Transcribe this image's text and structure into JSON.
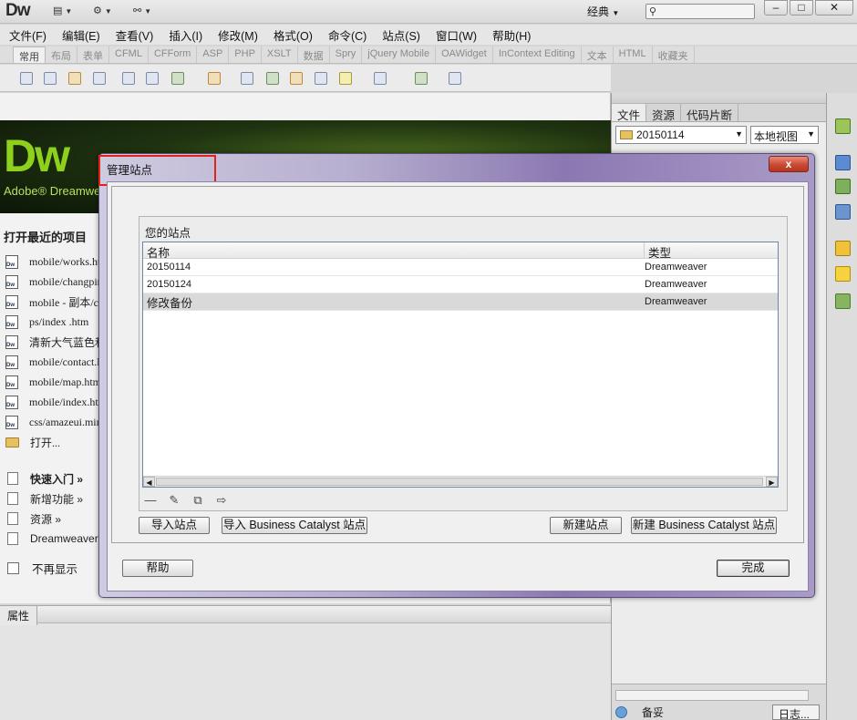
{
  "app": {
    "logo": "Dw",
    "workspace": "经典",
    "window_buttons": [
      "–",
      "□",
      "✕"
    ]
  },
  "menu": [
    "文件(F)",
    "编辑(E)",
    "查看(V)",
    "插入(I)",
    "修改(M)",
    "格式(O)",
    "命令(C)",
    "站点(S)",
    "窗口(W)",
    "帮助(H)"
  ],
  "insert_tabs": [
    "常用",
    "布局",
    "表单",
    "CFML",
    "CFForm",
    "ASP",
    "PHP",
    "XSLT",
    "数据",
    "Spry",
    "jQuery Mobile",
    "OAWidget",
    "InContext Editing",
    "文本",
    "HTML",
    "收藏夹"
  ],
  "start_page": {
    "logo": "Dw",
    "brand": "Adobe® Dreamweaver",
    "recent_title": "打开最近的项目",
    "recent_items": [
      "mobile/works.ht",
      "mobile/changpin",
      "mobile - 副本/c",
      "ps/index .htm",
      "清新大气蓝色和",
      "mobile/contact.l",
      "mobile/map.htm",
      "mobile/index.htm",
      "css/amazeui.min"
    ],
    "open_label": "打开...",
    "quick_links": [
      "快速入门 »",
      "新增功能 »",
      "资源 »",
      "Dreamweaver E"
    ],
    "dont_show": "不再显示"
  },
  "properties": {
    "tab": "属性"
  },
  "files_panel": {
    "tabs": [
      "文件",
      "资源",
      "代码片断"
    ],
    "site": "20150114",
    "view": "本地视图",
    "status": "备妥",
    "log_button": "日志..."
  },
  "dialog": {
    "title": "管理站点",
    "close": "x",
    "group_label": "您的站点",
    "columns": [
      "名称",
      "类型"
    ],
    "rows": [
      {
        "name": "20150114",
        "type": "Dreamweaver",
        "selected": false
      },
      {
        "name": "20150124",
        "type": "Dreamweaver",
        "selected": false
      },
      {
        "name": "修改备份",
        "type": "Dreamweaver",
        "selected": true
      }
    ],
    "buttons": {
      "import_site": "导入站点",
      "import_bc": "导入 Business Catalyst 站点",
      "new_site": "新建站点",
      "new_bc": "新建 Business Catalyst 站点",
      "help": "帮助",
      "done": "完成"
    }
  }
}
